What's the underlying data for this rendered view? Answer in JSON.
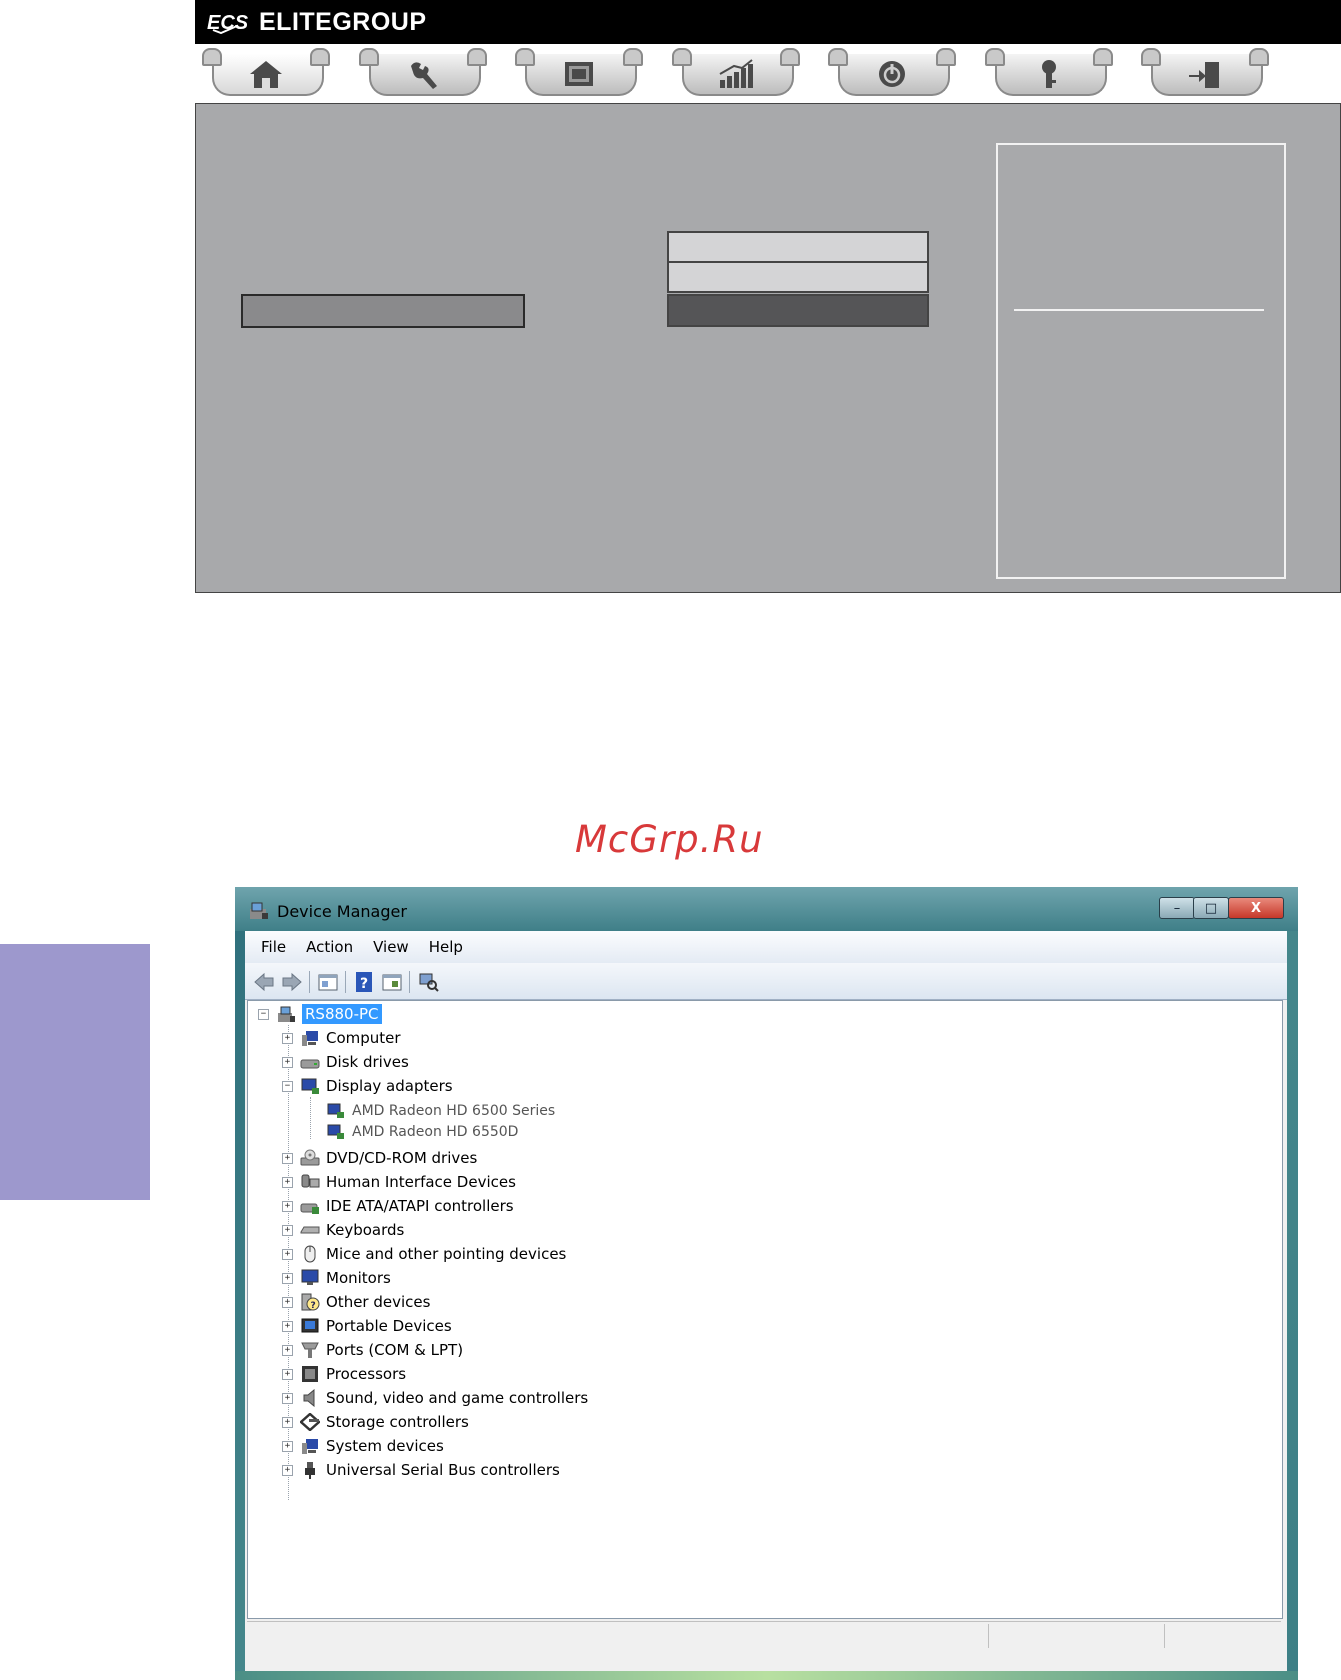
{
  "bios": {
    "brand": "ELITEGROUP",
    "tabs": [
      "home-icon",
      "wrench-icon",
      "chip-icon",
      "chart-icon",
      "power-icon",
      "key-icon",
      "exit-icon"
    ]
  },
  "watermark": "McGrp.Ru",
  "device_manager": {
    "title": "Device Manager",
    "window_buttons": {
      "minimize": "–",
      "maximize": "□",
      "close": "X"
    },
    "menu": [
      "File",
      "Action",
      "View",
      "Help"
    ],
    "toolbar": [
      "back-icon",
      "forward-icon",
      "properties-icon",
      "help-icon",
      "show-hide-icon",
      "scan-icon"
    ],
    "root": "RS880-PC",
    "categories": [
      {
        "label": "Computer",
        "expanded": false
      },
      {
        "label": "Disk drives",
        "expanded": false
      },
      {
        "label": "Display adapters",
        "expanded": true,
        "children": [
          "AMD Radeon HD 6500 Series",
          "AMD Radeon HD 6550D"
        ]
      },
      {
        "label": "DVD/CD-ROM drives",
        "expanded": false
      },
      {
        "label": "Human Interface Devices",
        "expanded": false
      },
      {
        "label": "IDE ATA/ATAPI controllers",
        "expanded": false
      },
      {
        "label": "Keyboards",
        "expanded": false
      },
      {
        "label": "Mice and other pointing devices",
        "expanded": false
      },
      {
        "label": "Monitors",
        "expanded": false
      },
      {
        "label": "Other devices",
        "expanded": false
      },
      {
        "label": "Portable Devices",
        "expanded": false
      },
      {
        "label": "Ports (COM & LPT)",
        "expanded": false
      },
      {
        "label": "Processors",
        "expanded": false
      },
      {
        "label": "Sound, video and game controllers",
        "expanded": false
      },
      {
        "label": "Storage controllers",
        "expanded": false
      },
      {
        "label": "System devices",
        "expanded": false
      },
      {
        "label": "Universal Serial Bus controllers",
        "expanded": false
      }
    ]
  }
}
